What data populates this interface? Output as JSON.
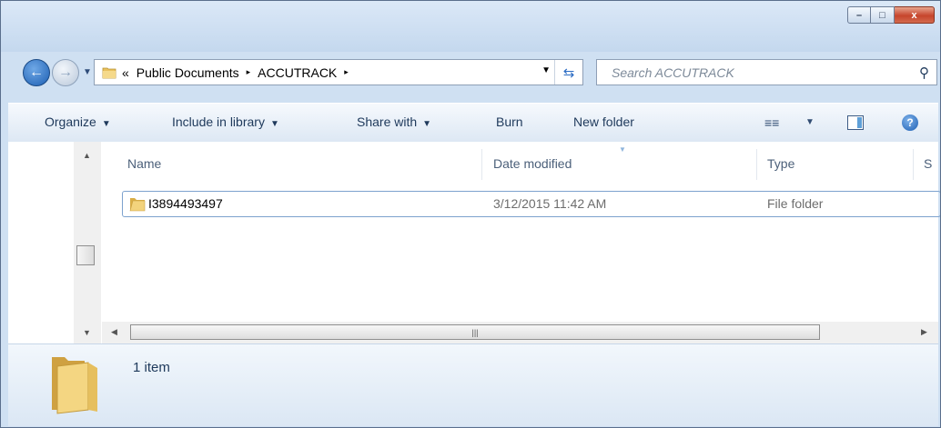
{
  "window": {
    "caption_buttons": {
      "minimize": "–",
      "maximize": "□",
      "close": "x"
    }
  },
  "nav": {
    "back_icon": "back-arrow-icon",
    "forward_icon": "forward-arrow-icon",
    "history_icon": "chevron-down-icon"
  },
  "address": {
    "overflow": "«",
    "crumbs": [
      "Public Documents",
      "ACCUTRACK"
    ],
    "separator": "▸",
    "refresh_glyph": "⇆"
  },
  "search": {
    "placeholder": "Search ACCUTRACK"
  },
  "commandbar": {
    "organize": "Organize",
    "include_in_library": "Include in library",
    "share_with": "Share with",
    "burn": "Burn",
    "new_folder": "New folder"
  },
  "columns": {
    "name": "Name",
    "date_modified": "Date modified",
    "type": "Type",
    "size_partial": "S"
  },
  "files": [
    {
      "name": "I3894493497",
      "date_modified": "3/12/2015 11:42 AM",
      "type": "File folder"
    }
  ],
  "status": {
    "count": "1 item"
  },
  "colors": {
    "accent": "#1e395b",
    "selection_border": "#7da2ce",
    "close_button": "#c6452c"
  }
}
